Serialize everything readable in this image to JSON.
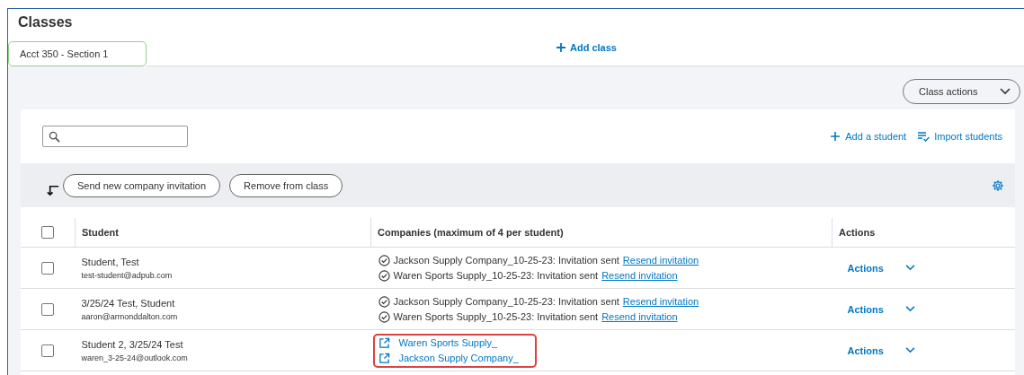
{
  "page_title": "Classes",
  "class_tabs": [
    {
      "label": "Acct 350 - Section 1",
      "selected": true
    }
  ],
  "add_class": "Add class",
  "class_actions": "Class actions",
  "add_student": "Add a student",
  "import_students": "Import students",
  "bulk_buttons": [
    "Send new company invitation",
    "Remove from class"
  ],
  "table": {
    "columns": [
      "Student",
      "Companies (maximum of 4 per student)",
      "Actions"
    ],
    "header_checked": false,
    "rows": [
      {
        "checked": false,
        "name": "Student, Test",
        "email": "test-student@adpub.com",
        "highlighted": false,
        "action": "Actions",
        "companies": [
          {
            "kind": "invited",
            "text": "Jackson Supply Company_10-25-23: Invitation sent",
            "link": "Resend invitation"
          },
          {
            "kind": "invited",
            "text": "Waren Sports Supply_10-25-23: Invitation sent",
            "link": "Resend invitation"
          }
        ]
      },
      {
        "checked": false,
        "name": "3/25/24 Test, Student",
        "email": "aaron@armonddalton.com",
        "highlighted": false,
        "action": "Actions",
        "companies": [
          {
            "kind": "invited",
            "text": "Jackson Supply Company_10-25-23: Invitation sent",
            "link": "Resend invitation"
          },
          {
            "kind": "invited",
            "text": "Waren Sports Supply_10-25-23: Invitation sent",
            "link": "Resend invitation"
          }
        ]
      },
      {
        "checked": false,
        "name": "Student 2, 3/25/24 Test",
        "email": "waren_3-25-24@outlook.com",
        "highlighted": true,
        "action": "Actions",
        "companies": [
          {
            "kind": "linked",
            "link": "Waren Sports Supply_"
          },
          {
            "kind": "linked",
            "link": "Jackson Supply Company_"
          }
        ]
      }
    ]
  }
}
